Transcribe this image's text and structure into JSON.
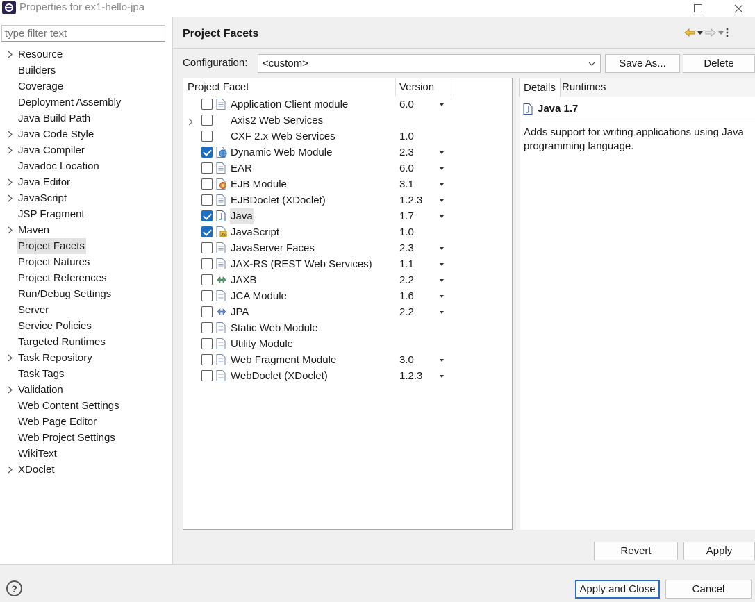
{
  "window": {
    "title": "Properties for ex1-hello-jpa",
    "minimize_icon": "minimize-icon",
    "maximize_icon": "maximize-icon",
    "close_icon": "close-icon"
  },
  "sidebar": {
    "filter_placeholder": "type filter text",
    "items": [
      {
        "label": "Resource",
        "expandable": true
      },
      {
        "label": "Builders",
        "expandable": false
      },
      {
        "label": "Coverage",
        "expandable": false
      },
      {
        "label": "Deployment Assembly",
        "expandable": false
      },
      {
        "label": "Java Build Path",
        "expandable": false
      },
      {
        "label": "Java Code Style",
        "expandable": true
      },
      {
        "label": "Java Compiler",
        "expandable": true
      },
      {
        "label": "Javadoc Location",
        "expandable": false
      },
      {
        "label": "Java Editor",
        "expandable": true
      },
      {
        "label": "JavaScript",
        "expandable": true
      },
      {
        "label": "JSP Fragment",
        "expandable": false
      },
      {
        "label": "Maven",
        "expandable": true
      },
      {
        "label": "Project Facets",
        "expandable": false,
        "selected": true
      },
      {
        "label": "Project Natures",
        "expandable": false
      },
      {
        "label": "Project References",
        "expandable": false
      },
      {
        "label": "Run/Debug Settings",
        "expandable": false
      },
      {
        "label": "Server",
        "expandable": false
      },
      {
        "label": "Service Policies",
        "expandable": false
      },
      {
        "label": "Targeted Runtimes",
        "expandable": false
      },
      {
        "label": "Task Repository",
        "expandable": true
      },
      {
        "label": "Task Tags",
        "expandable": false
      },
      {
        "label": "Validation",
        "expandable": true
      },
      {
        "label": "Web Content Settings",
        "expandable": false
      },
      {
        "label": "Web Page Editor",
        "expandable": false
      },
      {
        "label": "Web Project Settings",
        "expandable": false
      },
      {
        "label": "WikiText",
        "expandable": false
      },
      {
        "label": "XDoclet",
        "expandable": true
      }
    ]
  },
  "page": {
    "title": "Project Facets",
    "configuration_label": "Configuration:",
    "configuration_value": "<custom>",
    "save_as_label": "Save As...",
    "delete_label": "Delete"
  },
  "facet_table": {
    "col_facet": "Project Facet",
    "col_version": "Version",
    "rows": [
      {
        "name": "Application Client module",
        "version": "6.0",
        "checked": false,
        "dropdown": true,
        "icon": "document-icon",
        "expandable": false
      },
      {
        "name": "Axis2 Web Services",
        "version": "",
        "checked": false,
        "dropdown": false,
        "icon": "",
        "expandable": true
      },
      {
        "name": "CXF 2.x Web Services",
        "version": "1.0",
        "checked": false,
        "dropdown": false,
        "icon": "",
        "expandable": false
      },
      {
        "name": "Dynamic Web Module",
        "version": "2.3",
        "checked": true,
        "dropdown": true,
        "icon": "web-module-icon",
        "expandable": false
      },
      {
        "name": "EAR",
        "version": "6.0",
        "checked": false,
        "dropdown": true,
        "icon": "document-icon",
        "expandable": false
      },
      {
        "name": "EJB Module",
        "version": "3.1",
        "checked": false,
        "dropdown": true,
        "icon": "ejb-icon",
        "expandable": false
      },
      {
        "name": "EJBDoclet (XDoclet)",
        "version": "1.2.3",
        "checked": false,
        "dropdown": true,
        "icon": "document-icon",
        "expandable": false
      },
      {
        "name": "Java",
        "version": "1.7",
        "checked": true,
        "dropdown": true,
        "icon": "java-icon",
        "expandable": false,
        "selected": true
      },
      {
        "name": "JavaScript",
        "version": "1.0",
        "checked": true,
        "dropdown": false,
        "icon": "javascript-icon",
        "expandable": false
      },
      {
        "name": "JavaServer Faces",
        "version": "2.3",
        "checked": false,
        "dropdown": true,
        "icon": "document-icon",
        "expandable": false
      },
      {
        "name": "JAX-RS (REST Web Services)",
        "version": "1.1",
        "checked": false,
        "dropdown": true,
        "icon": "document-icon",
        "expandable": false
      },
      {
        "name": "JAXB",
        "version": "2.2",
        "checked": false,
        "dropdown": true,
        "icon": "jaxb-icon",
        "expandable": false
      },
      {
        "name": "JCA Module",
        "version": "1.6",
        "checked": false,
        "dropdown": true,
        "icon": "document-icon",
        "expandable": false
      },
      {
        "name": "JPA",
        "version": "2.2",
        "checked": false,
        "dropdown": true,
        "icon": "jpa-icon",
        "expandable": false
      },
      {
        "name": "Static Web Module",
        "version": "",
        "checked": false,
        "dropdown": false,
        "icon": "document-icon",
        "expandable": false
      },
      {
        "name": "Utility Module",
        "version": "",
        "checked": false,
        "dropdown": false,
        "icon": "document-icon",
        "expandable": false
      },
      {
        "name": "Web Fragment Module",
        "version": "3.0",
        "checked": false,
        "dropdown": true,
        "icon": "document-icon",
        "expandable": false
      },
      {
        "name": "WebDoclet (XDoclet)",
        "version": "1.2.3",
        "checked": false,
        "dropdown": true,
        "icon": "document-icon",
        "expandable": false
      }
    ]
  },
  "details": {
    "tab_details": "Details",
    "tab_runtimes": "Runtimes",
    "facet_title": "Java 1.7",
    "facet_description": "Adds support for writing applications using Java programming language."
  },
  "buttons": {
    "revert": "Revert",
    "apply": "Apply",
    "apply_and_close": "Apply and Close",
    "cancel": "Cancel",
    "help_icon": "help-icon"
  },
  "colors": {
    "accent": "#1b6ec2",
    "selection": "#e2e2e2"
  }
}
